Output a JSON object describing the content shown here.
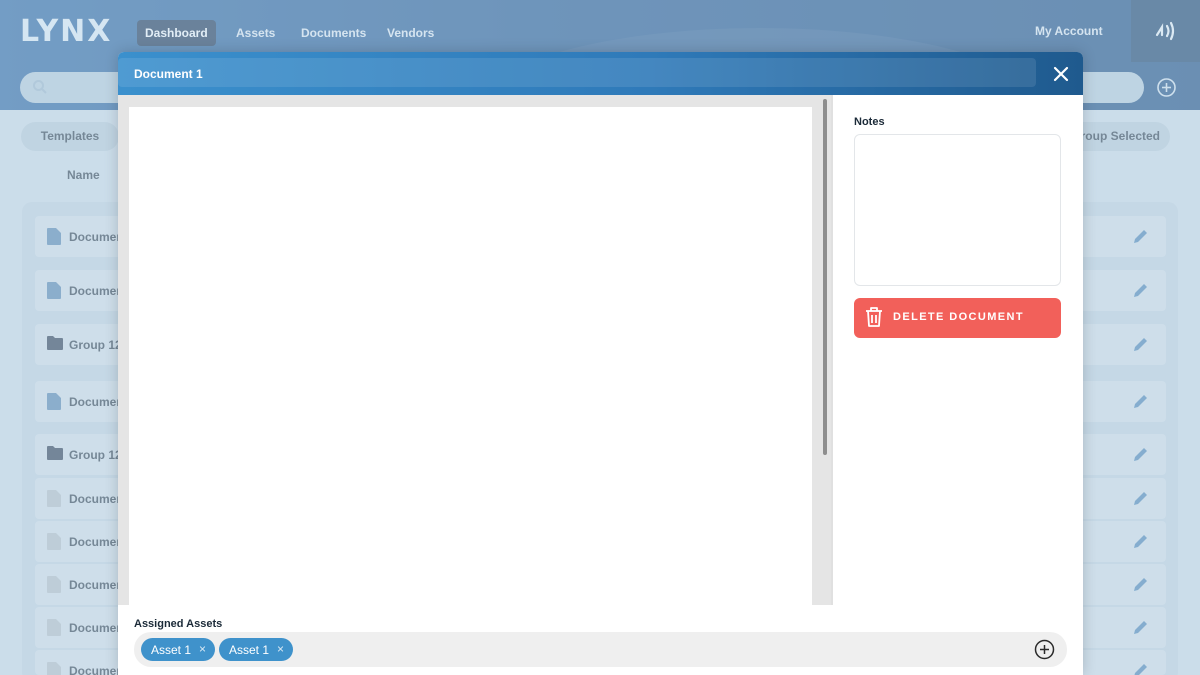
{
  "app": {
    "logo": "LYNX"
  },
  "nav": {
    "items": [
      {
        "label": "Dashboard"
      },
      {
        "label": "Assets"
      },
      {
        "label": "Documents"
      },
      {
        "label": "Vendors"
      }
    ],
    "account_label": "My Account"
  },
  "toolbar": {
    "templates_label": "Templates",
    "group_selected_label": "roup Selected"
  },
  "list": {
    "name_header": "Name",
    "rows": [
      {
        "label": "Documer",
        "icon": "file-icon"
      },
      {
        "label": "Documer",
        "icon": "file-icon"
      },
      {
        "label": "Group 12",
        "icon": "folder-icon"
      },
      {
        "label": "Documer",
        "icon": "file-icon"
      },
      {
        "label": "Group 12",
        "icon": "folder-icon"
      },
      {
        "label": "Documer",
        "icon": "file-icon"
      },
      {
        "label": "Documer",
        "icon": "file-icon"
      },
      {
        "label": "Documer",
        "icon": "file-icon"
      },
      {
        "label": "Documer",
        "icon": "file-icon"
      },
      {
        "label": "Documer",
        "icon": "file-icon"
      }
    ]
  },
  "modal": {
    "title": "Document 1",
    "notes_label": "Notes",
    "notes_value": "",
    "delete_label": "DELETE DOCUMENT",
    "assigned_label": "Assigned Assets",
    "assets": [
      {
        "label": "Asset 1",
        "remove": "×"
      },
      {
        "label": "Asset 1",
        "remove": "×"
      }
    ]
  },
  "colors": {
    "accent": "#3f92cb",
    "danger": "#f2605a",
    "header_dark": "#0d2f55"
  }
}
